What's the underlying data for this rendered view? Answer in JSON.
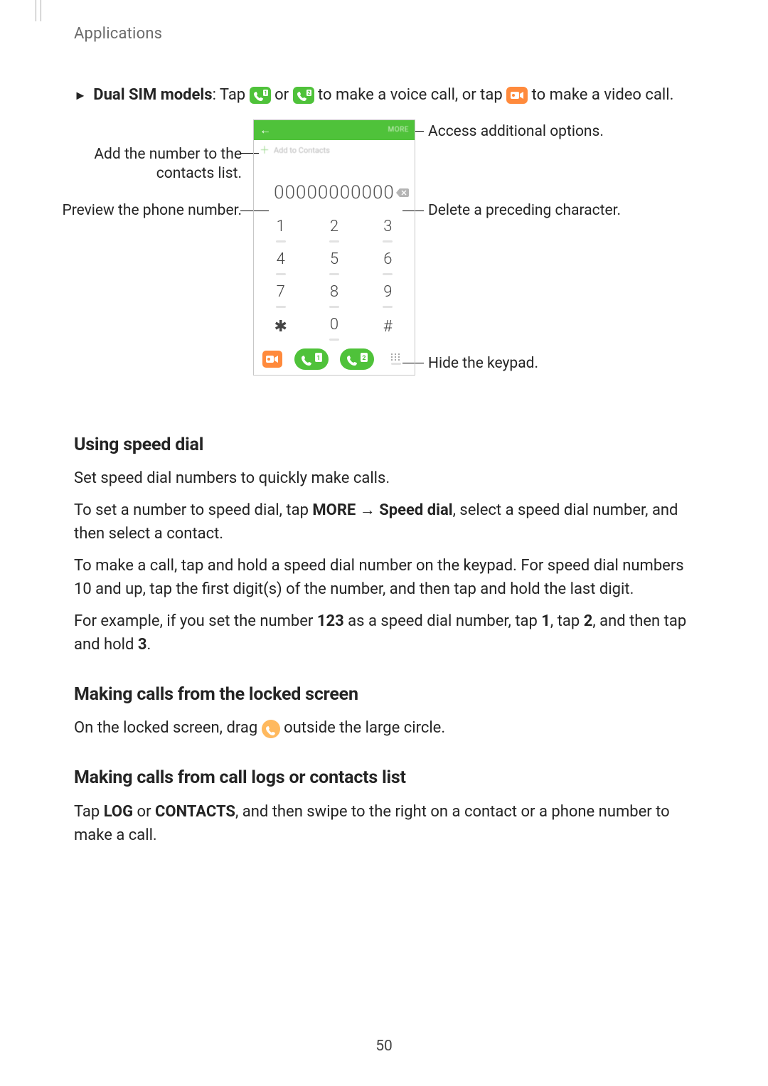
{
  "header": {
    "title": "Applications"
  },
  "intro": {
    "bullet": "►",
    "bold_prefix": "Dual SIM models",
    "text_1": ": Tap ",
    "text_or": " or ",
    "text_2": " to make a voice call, or tap ",
    "text_3": " to make a video call."
  },
  "callouts": {
    "left_1": "Add the number to the contacts list.",
    "left_2": "Preview the phone number.",
    "right_1": "Access additional options.",
    "right_2": "Delete a preceding character.",
    "right_3": "Hide the keypad."
  },
  "phone": {
    "more_label": "MORE",
    "add_contacts": "Add to Contacts",
    "number": "00000000000",
    "keys": [
      "1",
      "2",
      "3",
      "4",
      "5",
      "6",
      "7",
      "8",
      "9",
      "✱",
      "0",
      "#"
    ],
    "sim1": "1",
    "sim2": "2"
  },
  "sections": {
    "speed_dial": {
      "heading": "Using speed dial",
      "p1": "Set speed dial numbers to quickly make calls.",
      "p2_pre": "To set a number to speed dial, tap ",
      "p2_more": "MORE",
      "p2_arrow": " → ",
      "p2_sd": "Speed dial",
      "p2_post": ", select a speed dial number, and then select a contact.",
      "p3": "To make a call, tap and hold a speed dial number on the keypad. For speed dial numbers 10 and up, tap the first digit(s) of the number, and then tap and hold the last digit.",
      "p4_pre": "For example, if you set the number ",
      "p4_n123": "123",
      "p4_mid1": " as a speed dial number, tap ",
      "p4_n1": "1",
      "p4_mid2": ", tap ",
      "p4_n2": "2",
      "p4_mid3": ", and then tap and hold ",
      "p4_n3": "3",
      "p4_end": "."
    },
    "locked": {
      "heading": "Making calls from the locked screen",
      "p1_pre": "On the locked screen, drag ",
      "p1_post": " outside the large circle."
    },
    "logs": {
      "heading": "Making calls from call logs or contacts list",
      "p1_pre": "Tap ",
      "p1_log": "LOG",
      "p1_or": " or ",
      "p1_contacts": "CONTACTS",
      "p1_post": ", and then swipe to the right on a contact or a phone number to make a call."
    }
  },
  "page_number": "50"
}
